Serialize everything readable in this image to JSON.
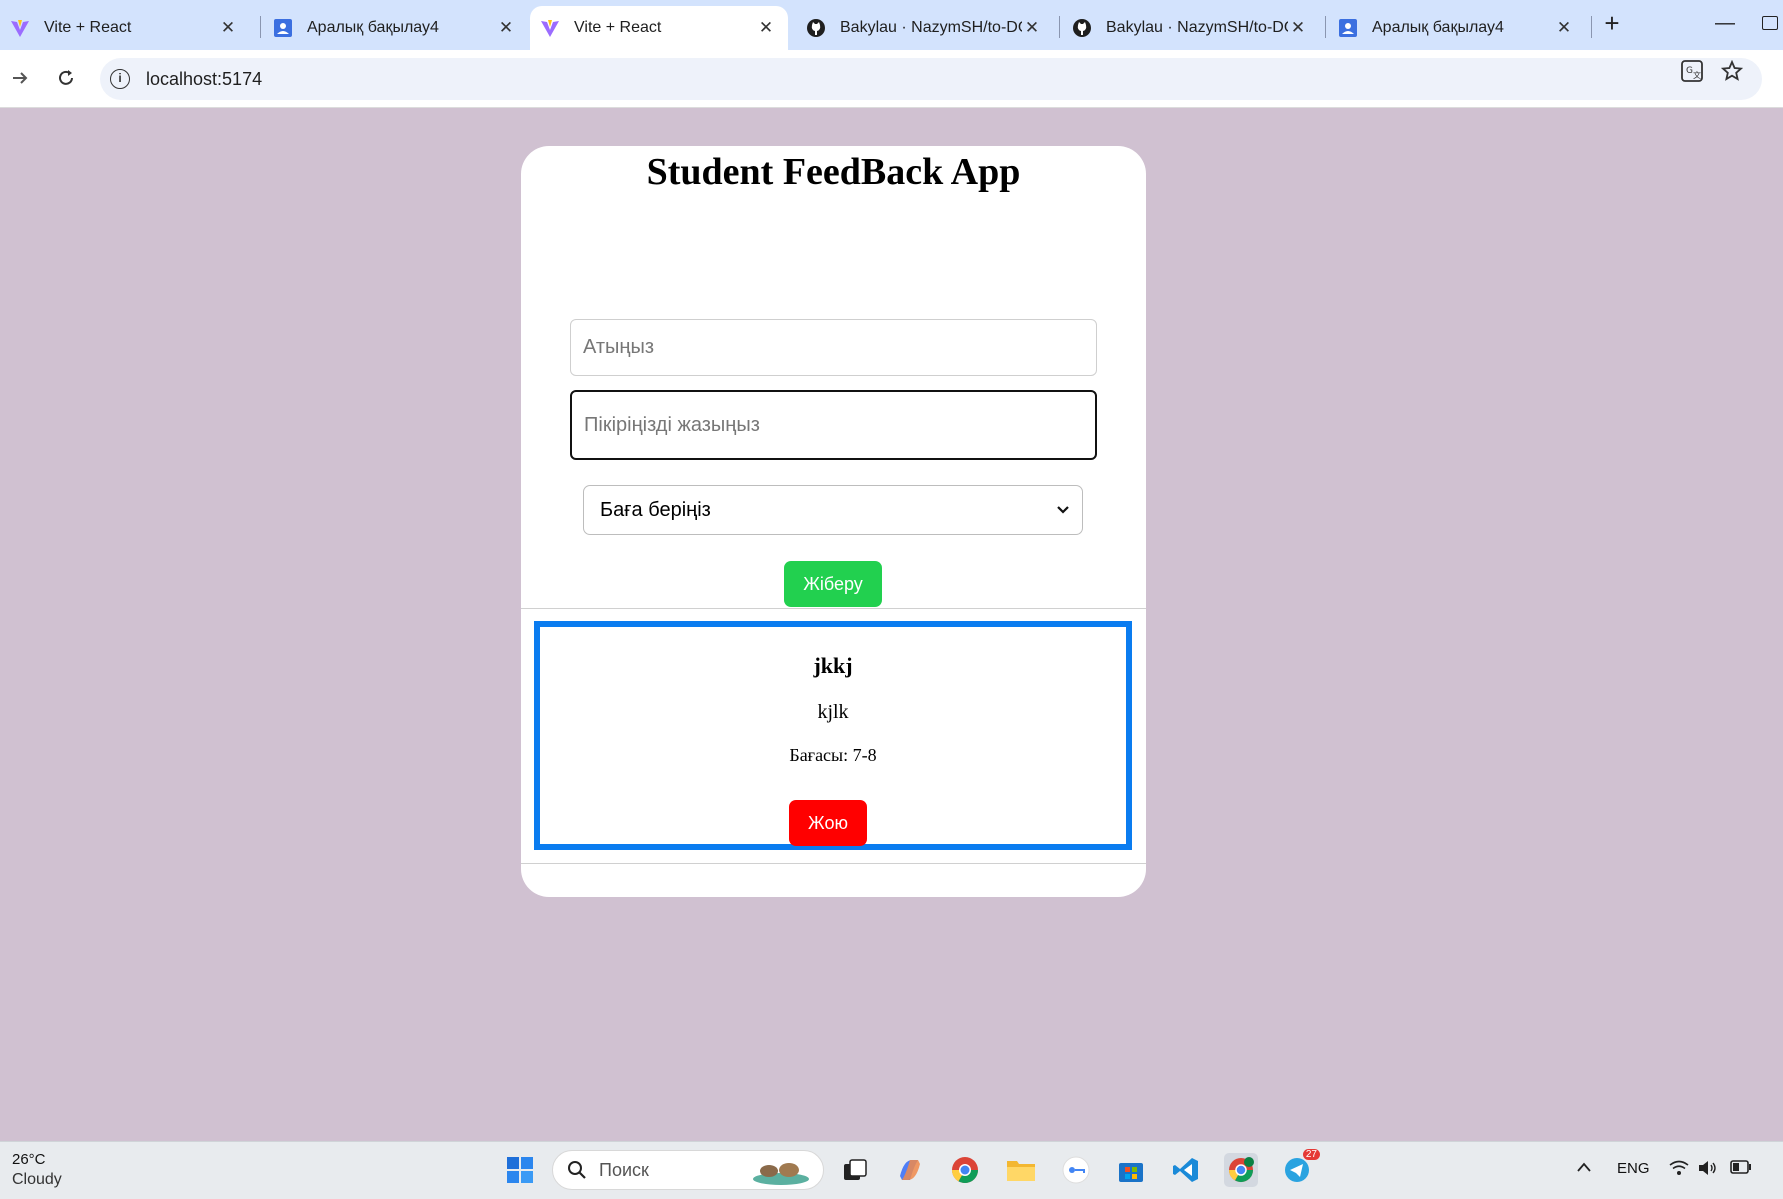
{
  "browser": {
    "tabs": [
      {
        "title": "Vite + React",
        "icon": "vite-icon",
        "active": false
      },
      {
        "title": "Аралық бақылау4",
        "icon": "forms-icon",
        "active": false
      },
      {
        "title": "Vite + React",
        "icon": "vite-icon",
        "active": true
      },
      {
        "title": "Bakylau · NazymSH/to-DO",
        "icon": "github-icon",
        "active": false
      },
      {
        "title": "Bakylau · NazymSH/to-DO",
        "icon": "github-icon",
        "active": false
      },
      {
        "title": "Аралық бақылау4",
        "icon": "forms-icon",
        "active": false
      }
    ],
    "close_glyph": "✕",
    "new_tab_glyph": "+",
    "url": "localhost:5174"
  },
  "app": {
    "title": "Student FeedBack App",
    "name_placeholder": "Атыңыз",
    "comment_placeholder": "Пікіріңізді жазыңыз",
    "rating_select_label": "Баға беріңіз",
    "submit_label": "Жіберу"
  },
  "feedback": [
    {
      "name": "jkkj",
      "text": "kjlk",
      "rating_text": "Бағасы: 7-8",
      "delete_label": "Жою"
    }
  ],
  "taskbar": {
    "weather_temp": "26°C",
    "weather_desc": "Cloudy",
    "search_placeholder": "Поиск",
    "language": "ENG",
    "telegram_badge": "27"
  },
  "colors": {
    "page_bg": "#d0c1d1",
    "submit": "#22d04f",
    "delete": "#ff0000",
    "item_border": "#0a7cf0"
  }
}
